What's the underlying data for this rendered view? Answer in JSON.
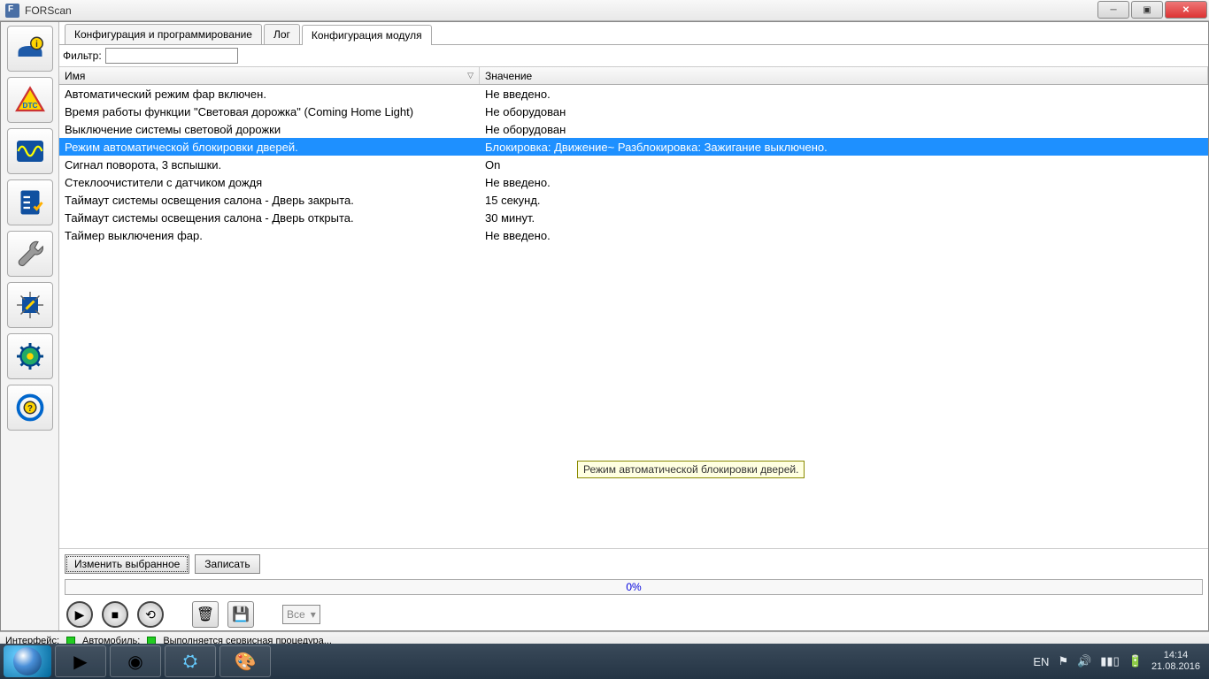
{
  "window": {
    "title": "FORScan"
  },
  "tabs": [
    {
      "label": "Конфигурация и программирование"
    },
    {
      "label": "Лог"
    },
    {
      "label": "Конфигурация модуля"
    }
  ],
  "filter": {
    "label": "Фильтр:",
    "value": ""
  },
  "columns": {
    "name": "Имя",
    "value": "Значение"
  },
  "rows": [
    {
      "name": "Автоматический режим фар включен.",
      "value": "Не введено."
    },
    {
      "name": "Время работы функции \"Световая дорожка\" (Coming Home Light)",
      "value": "Не оборудован"
    },
    {
      "name": "Выключение системы световой дорожки",
      "value": "Не оборудован"
    },
    {
      "name": "Режим автоматической блокировки дверей.",
      "value": "Блокировка: Движение~ Разблокировка: Зажигание выключено."
    },
    {
      "name": "Сигнал поворота, 3 вспышки.",
      "value": "On"
    },
    {
      "name": "Стеклоочистители с датчиком дождя",
      "value": "Не введено."
    },
    {
      "name": "Таймаут системы освещения салона - Дверь закрыта.",
      "value": "15 секунд."
    },
    {
      "name": "Таймаут системы освещения салона - Дверь открыта.",
      "value": "30 минут."
    },
    {
      "name": "Таймер выключения фар.",
      "value": "Не введено."
    }
  ],
  "selected_index": 3,
  "tooltip": "Режим автоматической блокировки дверей.",
  "actions": {
    "edit": "Изменить выбранное",
    "write": "Записать"
  },
  "progress": {
    "text": "0%"
  },
  "combo": {
    "label": "Все"
  },
  "status": {
    "interface": "Интерфейс:",
    "vehicle": "Автомобиль:",
    "procedure": "Выполняется сервисная процедура..."
  },
  "tray": {
    "lang": "EN",
    "time": "14:14",
    "date": "21.08.2016"
  }
}
